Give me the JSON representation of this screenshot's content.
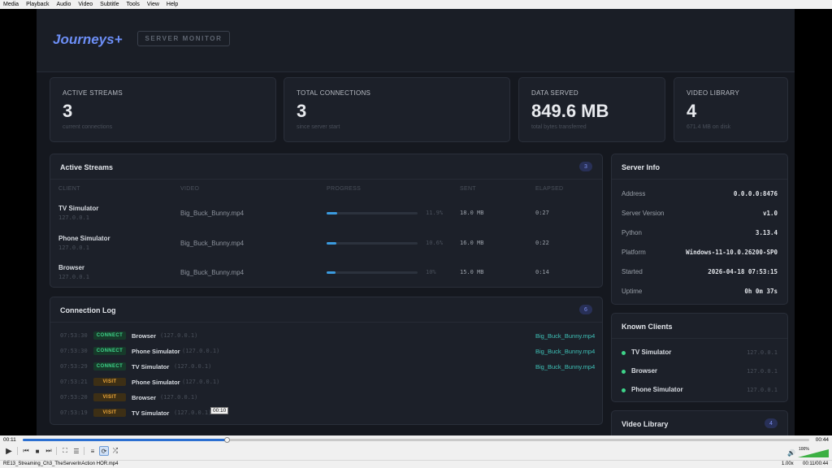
{
  "menubar": [
    "Media",
    "Playback",
    "Audio",
    "Video",
    "Subtitle",
    "Tools",
    "View",
    "Help"
  ],
  "app": {
    "brand": "Journeys+",
    "badge": "SERVER MONITOR"
  },
  "stats": [
    {
      "label": "ACTIVE STREAMS",
      "value": "3",
      "sub": "current connections"
    },
    {
      "label": "TOTAL CONNECTIONS",
      "value": "3",
      "sub": "since server start"
    },
    {
      "label": "DATA SERVED",
      "value": "849.6 MB",
      "sub": "total bytes transferred"
    },
    {
      "label": "VIDEO LIBRARY",
      "value": "4",
      "sub": "671.4 MB on disk"
    }
  ],
  "streams": {
    "title": "Active Streams",
    "count": "3",
    "headers": [
      "CLIENT",
      "VIDEO",
      "PROGRESS",
      "SENT",
      "ELAPSED"
    ],
    "rows": [
      {
        "client": "TV Simulator",
        "ip": "127.0.0.1",
        "video": "Big_Buck_Bunny.mp4",
        "progress": 0.119,
        "pct": "11.9%",
        "sent": "18.0 MB",
        "elapsed": "0:27"
      },
      {
        "client": "Phone Simulator",
        "ip": "127.0.0.1",
        "video": "Big_Buck_Bunny.mp4",
        "progress": 0.106,
        "pct": "10.6%",
        "sent": "16.0 MB",
        "elapsed": "0:22"
      },
      {
        "client": "Browser",
        "ip": "127.0.0.1",
        "video": "Big_Buck_Bunny.mp4",
        "progress": 0.1,
        "pct": "10%",
        "sent": "15.0 MB",
        "elapsed": "0:14"
      }
    ]
  },
  "log": {
    "title": "Connection Log",
    "count": "6",
    "rows": [
      {
        "time": "07:53:30",
        "type": "CONNECT",
        "client": "Browser",
        "ip": "(127.0.0.1)",
        "file": "Big_Buck_Bunny.mp4"
      },
      {
        "time": "07:53:30",
        "type": "CONNECT",
        "client": "Phone Simulator",
        "ip": "(127.0.0.1)",
        "file": "Big_Buck_Bunny.mp4"
      },
      {
        "time": "07:53:29",
        "type": "CONNECT",
        "client": "TV Simulator",
        "ip": "(127.0.0.1)",
        "file": "Big_Buck_Bunny.mp4"
      },
      {
        "time": "07:53:21",
        "type": "VISIT",
        "client": "Phone Simulator",
        "ip": "(127.0.0.1)",
        "file": ""
      },
      {
        "time": "07:53:20",
        "type": "VISIT",
        "client": "Browser",
        "ip": "(127.0.0.1)",
        "file": ""
      },
      {
        "time": "07:53:19",
        "type": "VISIT",
        "client": "TV Simulator",
        "ip": "(127.0.0.1)",
        "file": ""
      }
    ]
  },
  "server_info": {
    "title": "Server Info",
    "rows": [
      {
        "label": "Address",
        "value": "0.0.0.0:8476"
      },
      {
        "label": "Server Version",
        "value": "v1.0"
      },
      {
        "label": "Python",
        "value": "3.13.4"
      },
      {
        "label": "Platform",
        "value": "Windows-11-10.0.26200-SP0"
      },
      {
        "label": "Started",
        "value": "2026-04-18 07:53:15"
      },
      {
        "label": "Uptime",
        "value": "0h 0m 37s"
      }
    ]
  },
  "known_clients": {
    "title": "Known Clients",
    "rows": [
      {
        "name": "TV Simulator",
        "ip": "127.0.0.1"
      },
      {
        "name": "Browser",
        "ip": "127.0.0.1"
      },
      {
        "name": "Phone Simulator",
        "ip": "127.0.0.1"
      }
    ]
  },
  "video_library": {
    "title": "Video Library",
    "count": "4"
  },
  "player": {
    "tooltip": "00:10",
    "time_elapsed": "00:11",
    "time_total": "00:44",
    "seek_fraction": 0.26,
    "volume_label": "100%",
    "volume": 1.0,
    "speed": "1.00x",
    "status_time": "00:11/00:44",
    "filename": "RE13_Streaming_Ch3_TheServerInAction HOR.mp4"
  }
}
